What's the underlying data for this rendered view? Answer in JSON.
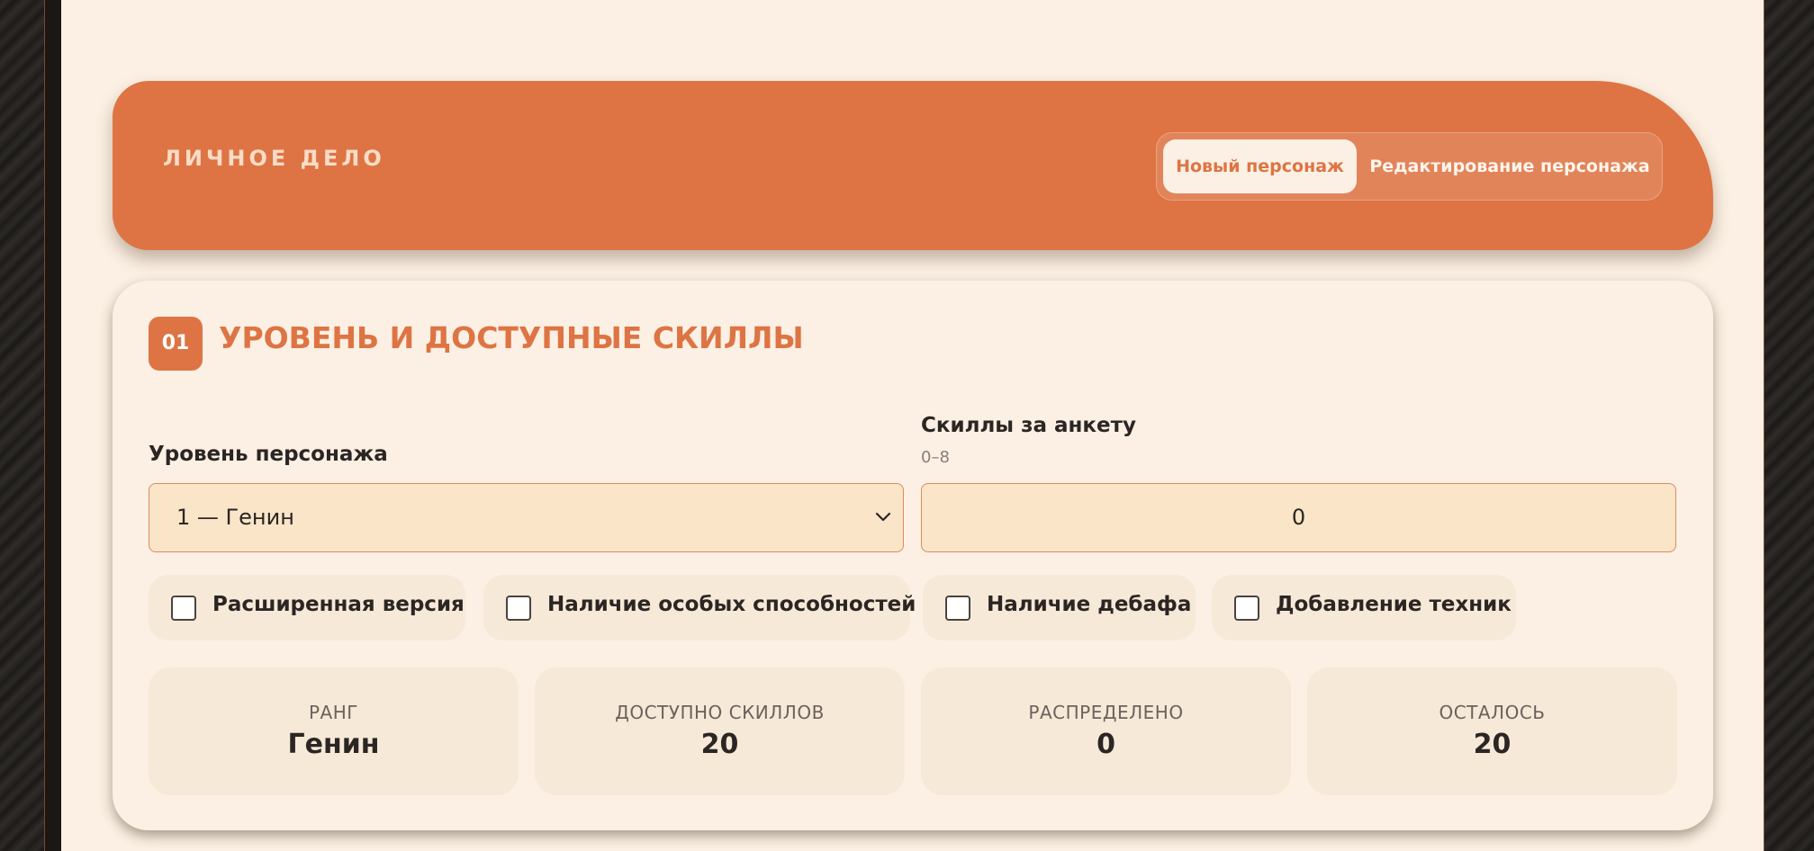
{
  "header": {
    "title": "ЛИЧНОЕ ДЕЛО",
    "tabs": [
      {
        "label": "Новый персонаж",
        "active": true
      },
      {
        "label": "Редактирование персонажа",
        "active": false
      }
    ]
  },
  "section": {
    "number": "01",
    "title": "УРОВЕНЬ И ДОСТУПНЫЕ СКИЛЛЫ",
    "level": {
      "label": "Уровень персонажа",
      "value": "1 — Генин"
    },
    "skills": {
      "label": "Скиллы за анкету",
      "hint": "0–8",
      "value": "0"
    },
    "checkboxes": [
      {
        "label": "Расширенная версия",
        "checked": false
      },
      {
        "label": "Наличие особых способностей",
        "checked": false
      },
      {
        "label": "Наличие дебафа",
        "checked": false
      },
      {
        "label": "Добавление техник",
        "checked": false
      }
    ],
    "stats": [
      {
        "label": "РАНГ",
        "value": "Генин"
      },
      {
        "label": "ДОСТУПНО СКИЛЛОВ",
        "value": "20"
      },
      {
        "label": "РАСПРЕДЕЛЕНО",
        "value": "0"
      },
      {
        "label": "ОСТАЛОСЬ",
        "value": "20"
      }
    ]
  },
  "colors": {
    "accent": "#de7444",
    "background": "#fbf0e3",
    "field": "#fae5c8",
    "panel": "#f7e9d8"
  }
}
